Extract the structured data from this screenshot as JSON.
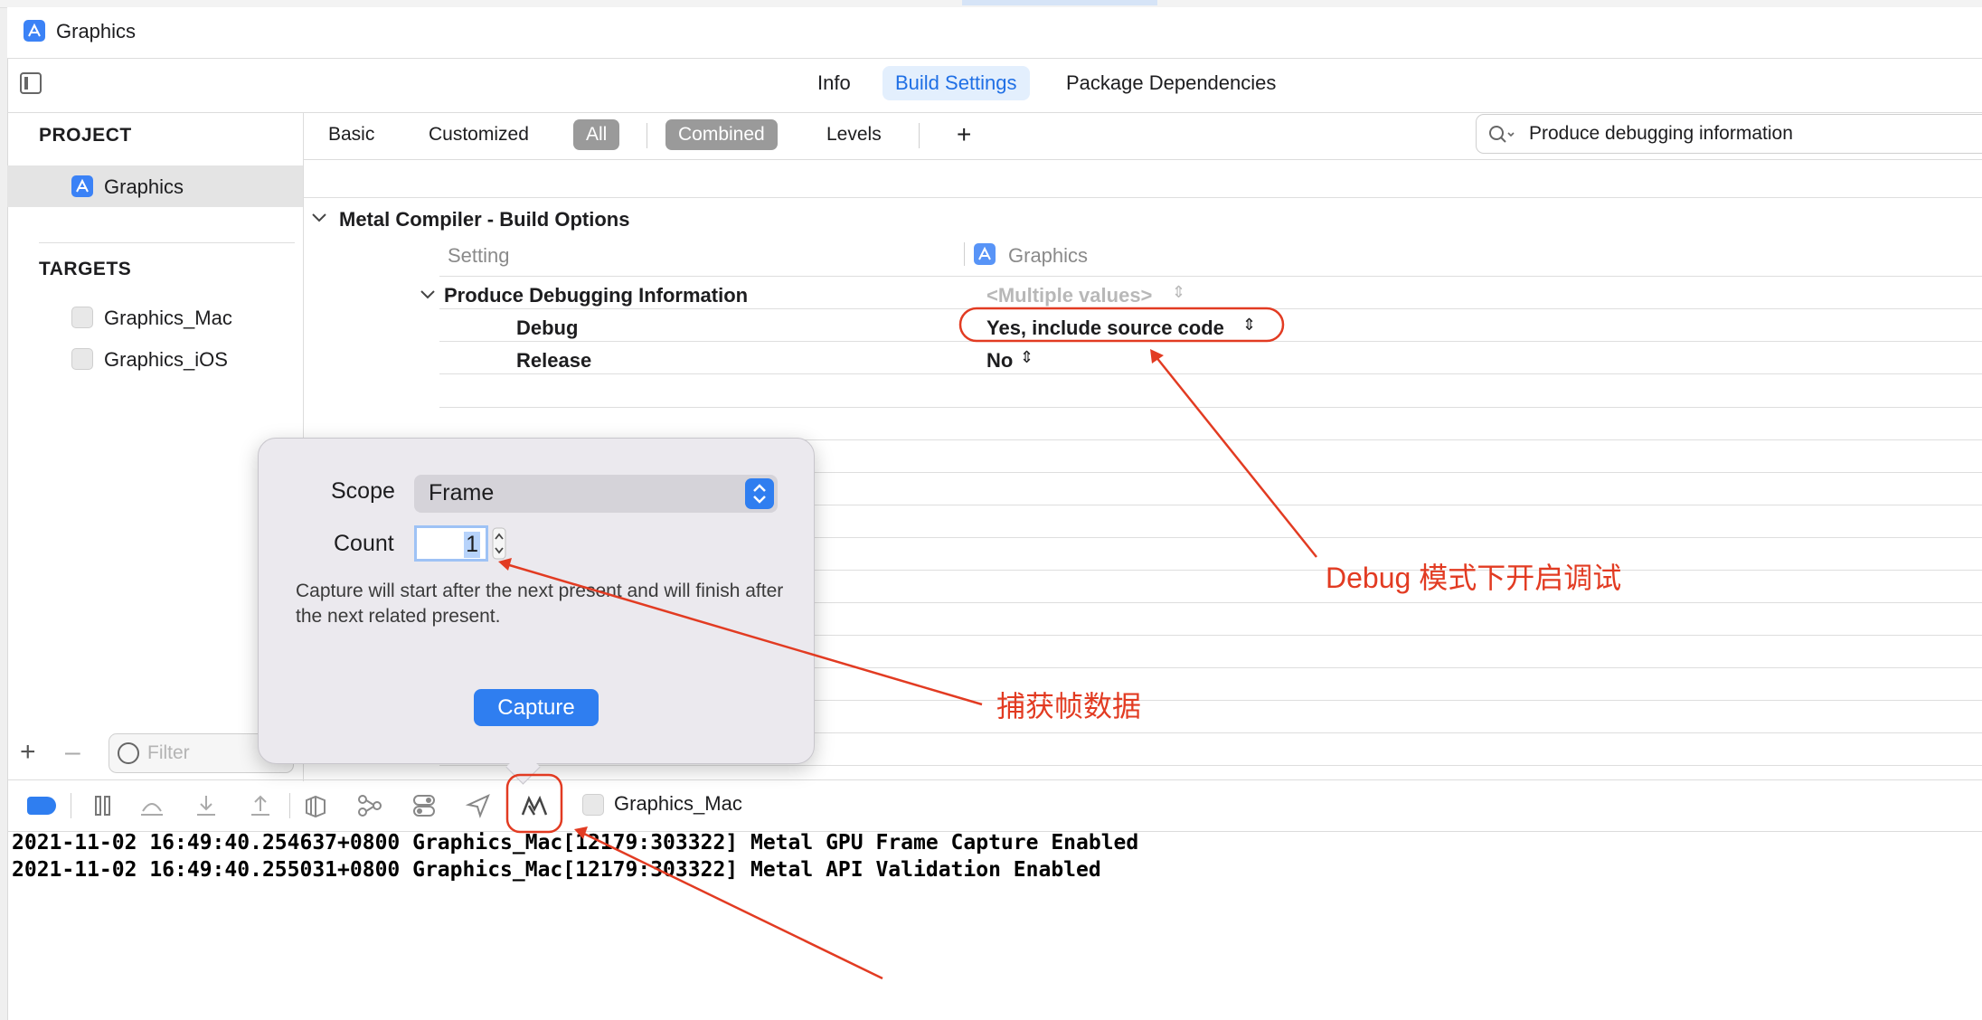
{
  "window": {
    "title": "Graphics"
  },
  "top_tabs": [
    "Info",
    "Build Settings",
    "Package Dependencies"
  ],
  "sidebar": {
    "project_header": "PROJECT",
    "project_item": "Graphics",
    "targets_header": "TARGETS",
    "targets": [
      "Graphics_Mac",
      "Graphics_iOS"
    ],
    "filter_placeholder": "Filter"
  },
  "filter_bar": {
    "basic": "Basic",
    "customized": "Customized",
    "all": "All",
    "combined": "Combined",
    "levels": "Levels",
    "add": "+"
  },
  "search": {
    "value": "Produce debugging information"
  },
  "settings": {
    "section_title": "Metal Compiler - Build Options",
    "col_setting": "Setting",
    "col_target": "Graphics",
    "setting_name": "Produce Debugging Information",
    "setting_value": "<Multiple values>",
    "rows": [
      {
        "config": "Debug",
        "value": "Yes, include source code"
      },
      {
        "config": "Release",
        "value": "No"
      }
    ]
  },
  "popover": {
    "scope_label": "Scope",
    "scope_value": "Frame",
    "count_label": "Count",
    "count_value": "1",
    "description": "Capture will start after the next present and will finish after the next related present.",
    "capture_button": "Capture"
  },
  "debug_bar": {
    "scheme_target": "Graphics_Mac"
  },
  "console": [
    "2021-11-02 16:49:40.254637+0800 Graphics_Mac[12179:303322] Metal GPU Frame Capture Enabled",
    "2021-11-02 16:49:40.255031+0800 Graphics_Mac[12179:303322] Metal API Validation Enabled"
  ],
  "annotations": {
    "debug_note": "Debug 模式下开启调试",
    "capture_note": "捕获帧数据",
    "color": "#e23b22"
  },
  "colors": {
    "accent": "#2f7ef0",
    "annotation": "#e23b22"
  }
}
